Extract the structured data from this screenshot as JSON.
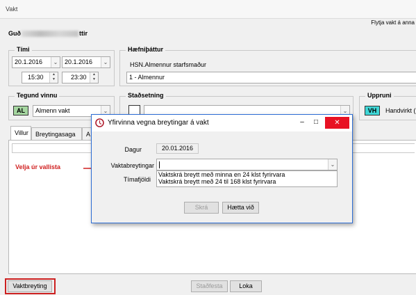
{
  "window": {
    "title": "Vakt",
    "move_shift": "Flytja vakt á anna"
  },
  "person": {
    "prefix": "Guð",
    "suffix": "ttir"
  },
  "time_group": {
    "label": "Tími",
    "from_date": "20.1.2016",
    "to_date": "20.1.2016",
    "from_time": "15:30",
    "to_time": "23:30"
  },
  "competency_group": {
    "label": "Hæfniþáttur",
    "name": "HSN.Almennur starfsmaður",
    "value": "1 - Almennur"
  },
  "work_type_group": {
    "label": "Tegund vinnu",
    "badge": "AL",
    "value": "Almenn vakt"
  },
  "location_group": {
    "label": "Staðsetning"
  },
  "origin_group": {
    "label": "Uppruni",
    "badge": "VH",
    "value": "Handvirkt ("
  },
  "tabs": [
    {
      "label": "Villur"
    },
    {
      "label": "Breytingasaga"
    },
    {
      "label": "A"
    }
  ],
  "bottom": {
    "shift_change_button": "Vaktbreyting",
    "confirm_button": "Staðfesta",
    "close_button": "Loka"
  },
  "callout": {
    "text": "Velja úr vallista"
  },
  "dialog": {
    "title": "Yfirvinna vegna breytingar á vakt",
    "date_label": "Dagur",
    "date_value": "20.01.2016",
    "change_label": "Vaktabreytingar",
    "change_value": "",
    "hours_label": "Tímafjöldi",
    "options": [
      "Vaktskrá breytt með minna en 24 klst fyrirvara",
      "Vaktskrá breytt með 24 til 168 klst fyrirvara"
    ],
    "save_button": "Skrá",
    "cancel_button": "Hætta við",
    "minimize": "–",
    "maximize": "□",
    "close": "✕"
  },
  "colors": {
    "work_type_badge": "#a5d6a0",
    "origin_badge": "#3fd6d6",
    "callout": "#d02020",
    "highlight_border": "#cc2020",
    "dialog_border": "#2b6cd4",
    "dialog_close": "#e81123"
  }
}
